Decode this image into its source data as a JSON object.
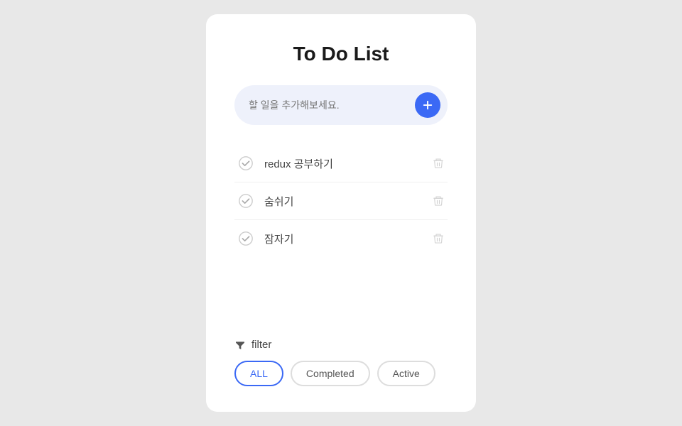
{
  "app": {
    "title": "To Do List"
  },
  "input": {
    "placeholder": "할 일을 추가해보세요."
  },
  "todos": [
    {
      "id": 1,
      "text": "redux 공부하기",
      "completed": true
    },
    {
      "id": 2,
      "text": "숨쉬기",
      "completed": true
    },
    {
      "id": 3,
      "text": "잠자기",
      "completed": true
    }
  ],
  "filter": {
    "label": "filter",
    "buttons": [
      {
        "id": "all",
        "label": "ALL",
        "active": true
      },
      {
        "id": "completed",
        "label": "Completed",
        "active": false
      },
      {
        "id": "active",
        "label": "Active",
        "active": false
      }
    ]
  }
}
